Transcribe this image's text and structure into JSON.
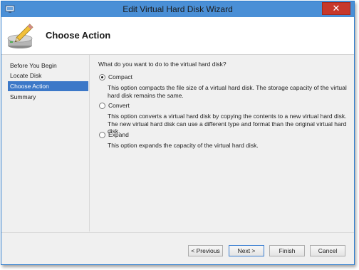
{
  "window": {
    "title": "Edit Virtual Hard Disk Wizard",
    "close_glyph": "✕"
  },
  "header": {
    "title": "Choose Action",
    "icon": "disk-with-pencil-icon"
  },
  "nav": {
    "items": [
      {
        "label": "Before You Begin",
        "active": false
      },
      {
        "label": "Locate Disk",
        "active": false
      },
      {
        "label": "Choose Action",
        "active": true
      },
      {
        "label": "Summary",
        "active": false
      }
    ]
  },
  "content": {
    "question": "What do you want to do to the virtual hard disk?",
    "options": [
      {
        "label": "Compact",
        "checked": true,
        "description": "This option compacts the file size of a virtual hard disk. The storage capacity of the virtual hard disk remains the same."
      },
      {
        "label": "Convert",
        "checked": false,
        "description": "This option converts a virtual hard disk by copying the contents to a new virtual hard disk. The new virtual hard disk can use a different type and format than the original virtual hard disk."
      },
      {
        "label": "Expand",
        "checked": false,
        "description": "This option expands the capacity of the virtual hard disk."
      }
    ]
  },
  "buttons": {
    "previous": "< Previous",
    "next": "Next >",
    "finish": "Finish",
    "cancel": "Cancel"
  },
  "colors": {
    "titlebar": "#4a8fd6",
    "nav_active": "#3c78c8",
    "close_button": "#c7382b"
  }
}
